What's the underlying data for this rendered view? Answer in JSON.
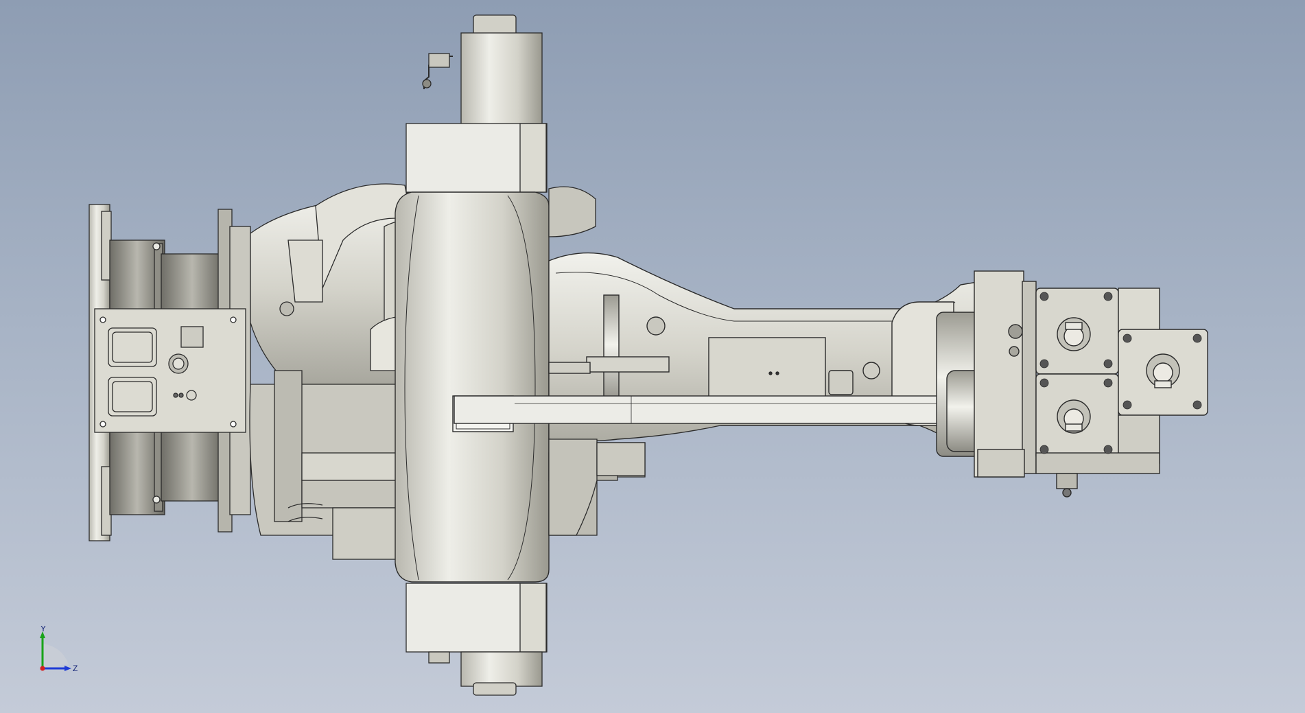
{
  "viewport": {
    "background_top": "#8e9db3",
    "background_bottom": "#c4cbd8"
  },
  "model": {
    "subject": "robot-arm-assembly",
    "body_color": "#d6d5cc",
    "shade_color": "#a9a89f",
    "edge_color": "#2b2b2b",
    "highlight_color": "#efefea"
  },
  "triad": {
    "y_label": "Y",
    "z_label": "Z",
    "y_color": "#19a31a",
    "z_color": "#1f3bd6",
    "x_color": "#d62020"
  }
}
